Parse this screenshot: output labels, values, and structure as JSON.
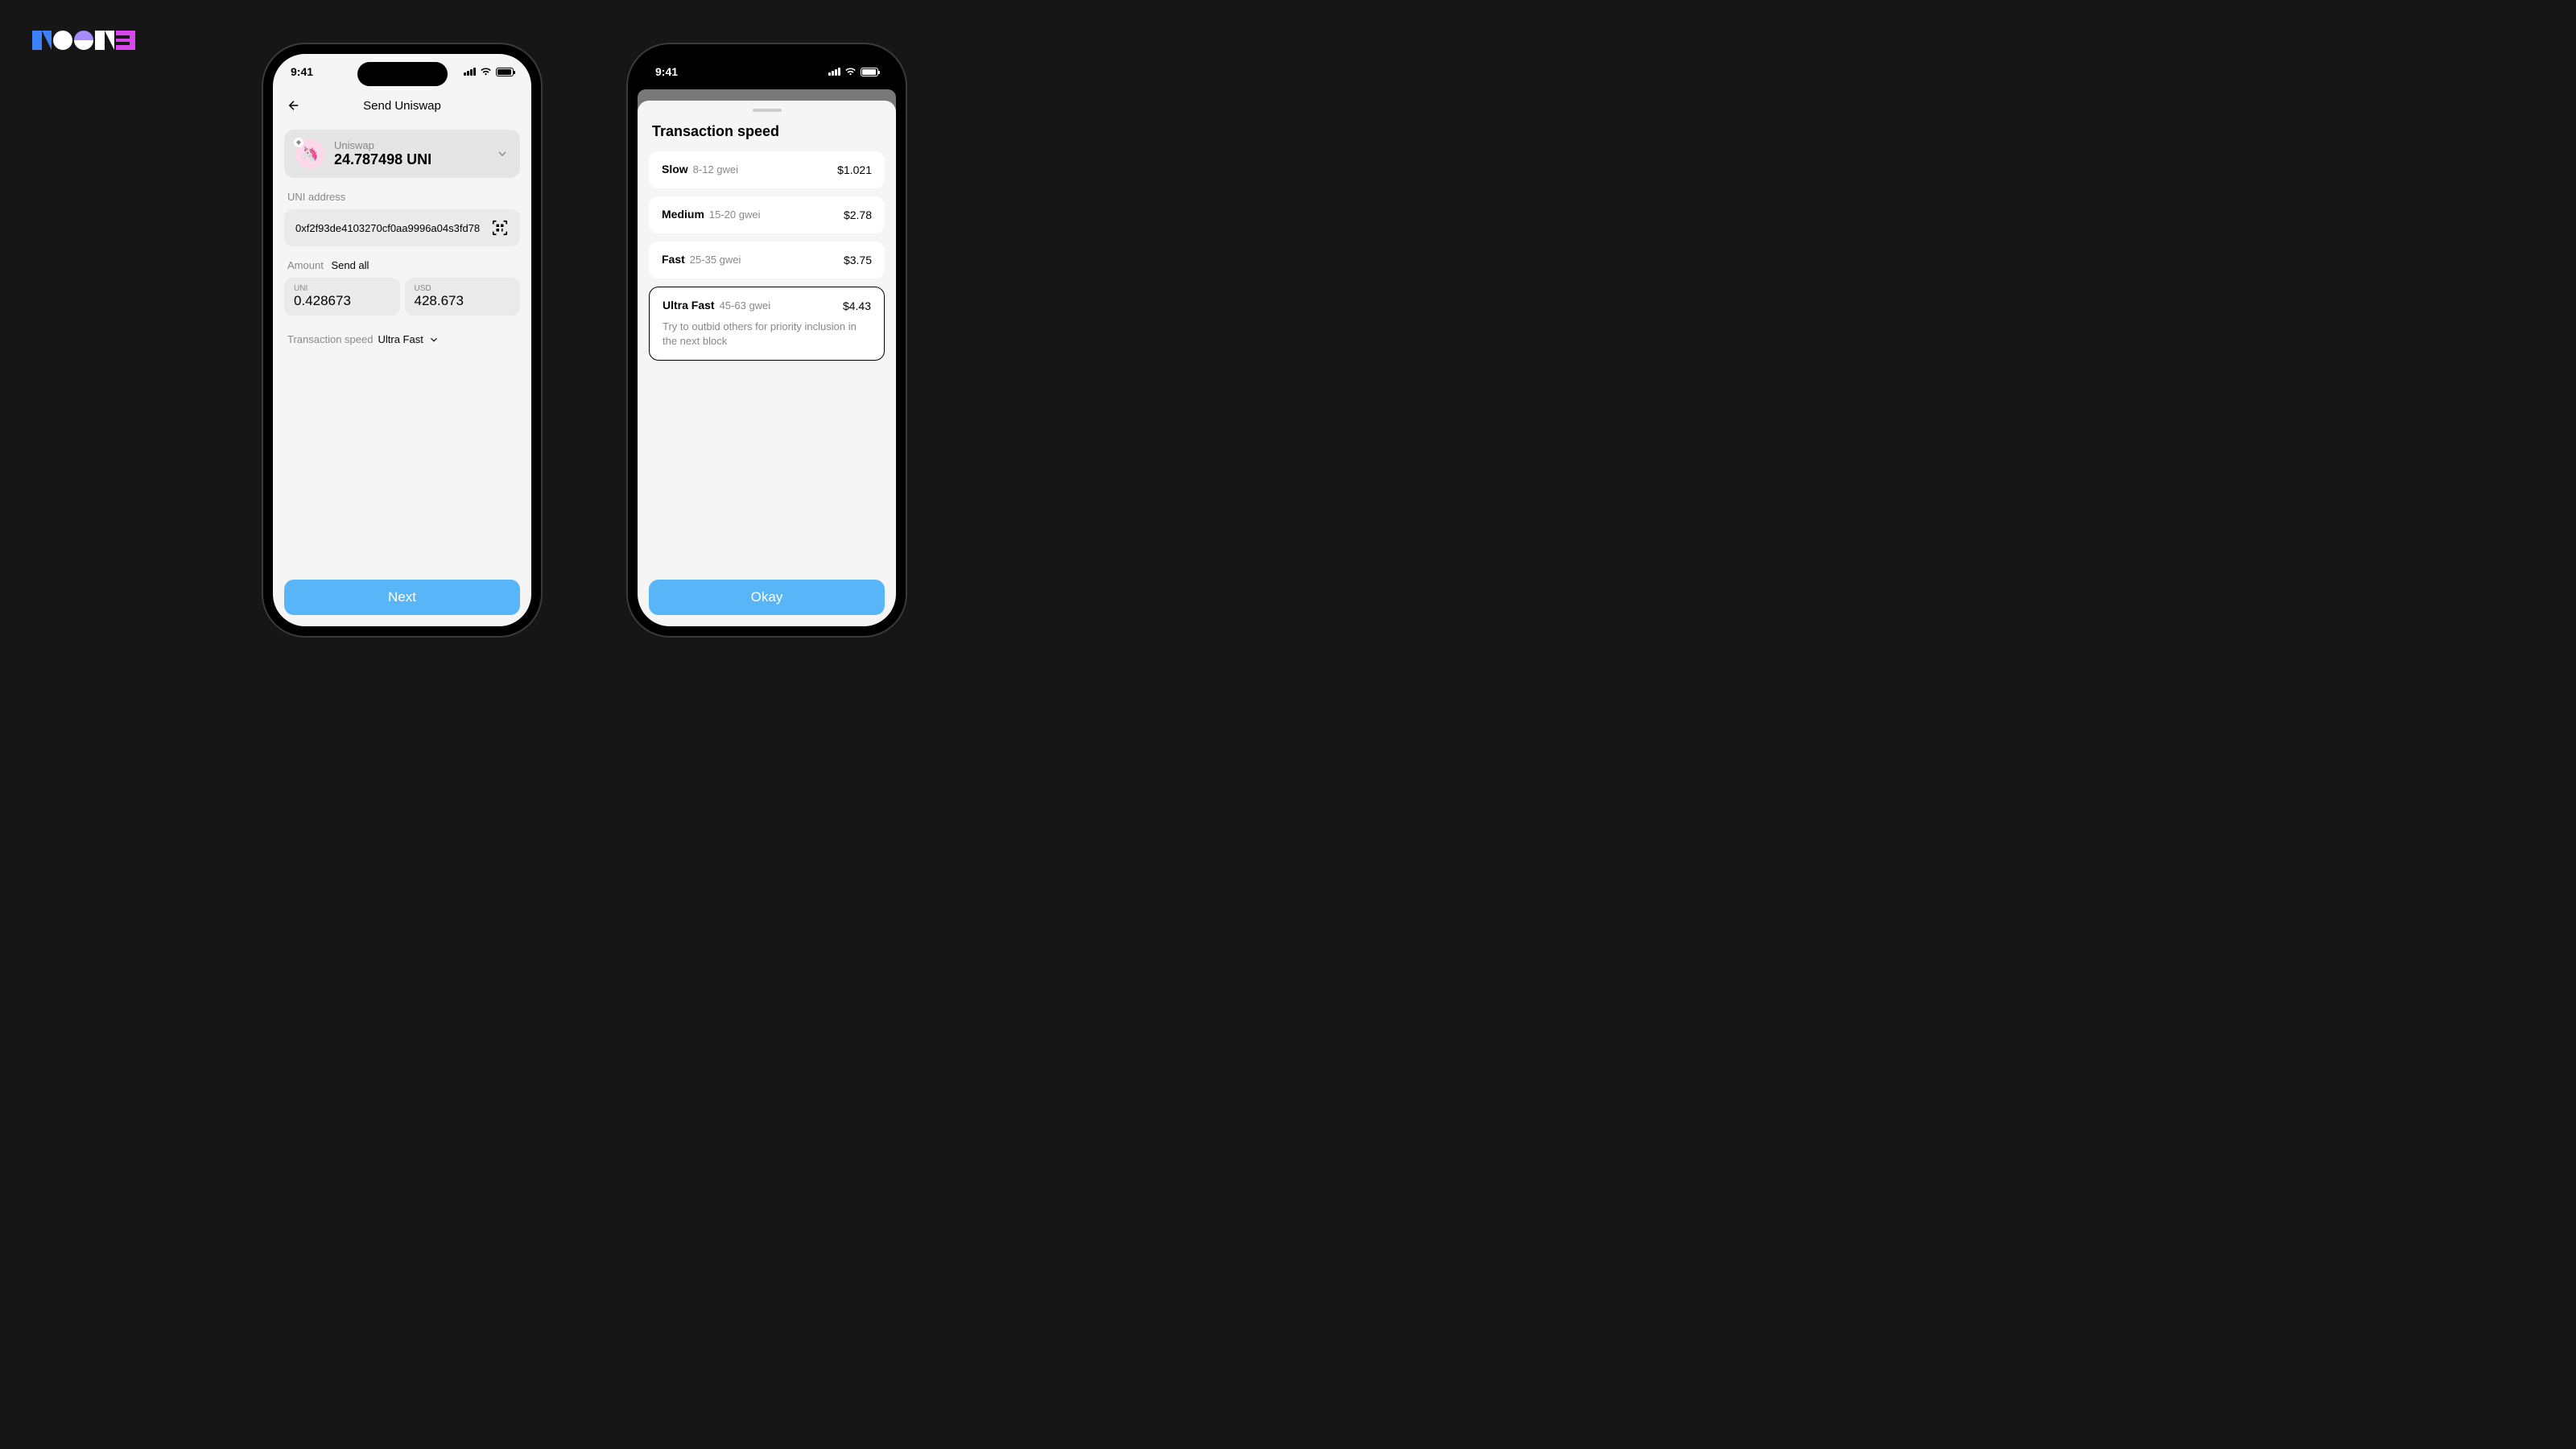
{
  "status": {
    "time": "9:41"
  },
  "screen1": {
    "title": "Send Uniswap",
    "token": {
      "name": "Uniswap",
      "balance": "24.787498 UNI",
      "icon": "🦄"
    },
    "address_label": "UNI address",
    "address_value": "0xf2f93de4103270cf0aa9996a04s3fd78",
    "amount_label": "Amount",
    "send_all": "Send all",
    "amount_uni_label": "UNI",
    "amount_uni_value": "0.428673",
    "amount_usd_label": "USD",
    "amount_usd_value": "428.673",
    "speed_label": "Transaction speed",
    "speed_value": "Ultra Fast",
    "next_btn": "Next"
  },
  "screen2": {
    "title": "Transaction speed",
    "options": [
      {
        "name": "Slow",
        "gwei": "8-12 gwei",
        "price": "$1.021"
      },
      {
        "name": "Medium",
        "gwei": "15-20 gwei",
        "price": "$2.78"
      },
      {
        "name": "Fast",
        "gwei": "25-35 gwei",
        "price": "$3.75"
      },
      {
        "name": "Ultra Fast",
        "gwei": "45-63 gwei",
        "price": "$4.43",
        "desc": "Try to outbid others for priority inclusion in the next block",
        "selected": true
      }
    ],
    "okay_btn": "Okay"
  }
}
